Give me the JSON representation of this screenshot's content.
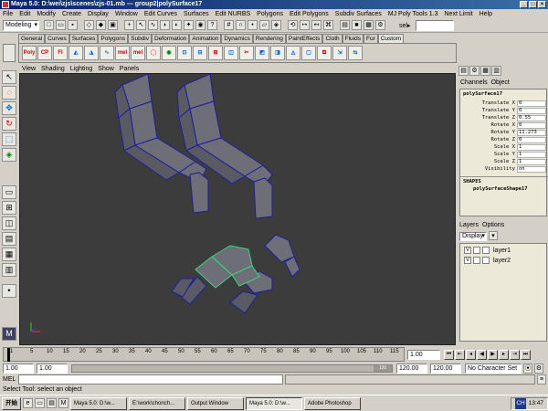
{
  "window": {
    "title": "Maya 5.0: D:\\wei\\zjs\\scenes\\zjs-01.mb  ---  group2|polySurface17"
  },
  "menubar": [
    "File",
    "Edit",
    "Modify",
    "Create",
    "Display",
    "Window",
    "Edit Curves",
    "Surfaces",
    "Edit NURBS",
    "Polygons",
    "Edit Polygons",
    "Subdiv Surfaces",
    "MJ Poly Tools 1.3",
    "Next Limit",
    "Help"
  ],
  "toolbar": {
    "mode": "Modeling",
    "sel_label": "sel▸"
  },
  "shelf": {
    "tabs": [
      "General",
      "Curves",
      "Surfaces",
      "Polygons",
      "Subdiv",
      "Deformation",
      "Animation",
      "Dynamics",
      "Rendering",
      "PaintEffects",
      "Cloth",
      "Fluids",
      "Fur",
      "Custom"
    ],
    "active_tab": "Custom",
    "icons": [
      "Poly",
      "CP",
      "FI",
      "",
      "",
      "mel",
      "mel",
      "",
      "",
      "",
      "",
      "",
      "",
      "",
      "",
      "",
      "",
      "",
      "",
      "",
      ""
    ]
  },
  "viewport": {
    "menu": [
      "View",
      "Shading",
      "Lighting",
      "Show",
      "Panels"
    ]
  },
  "channel_box": {
    "tabs": [
      "Channels",
      "Object"
    ],
    "object_name": "polySurface17",
    "channels": [
      {
        "name": "Translate X",
        "value": "0"
      },
      {
        "name": "Translate Y",
        "value": "0"
      },
      {
        "name": "Translate Z",
        "value": "0.55"
      },
      {
        "name": "Rotate X",
        "value": "0"
      },
      {
        "name": "Rotate Y",
        "value": "11.273"
      },
      {
        "name": "Rotate Z",
        "value": "0"
      },
      {
        "name": "Scale X",
        "value": "1"
      },
      {
        "name": "Scale Y",
        "value": "1"
      },
      {
        "name": "Scale Z",
        "value": "1"
      },
      {
        "name": "Visibility",
        "value": "on"
      }
    ],
    "shapes_header": "SHAPES",
    "shape_name": "polySurfaceShape17"
  },
  "layers": {
    "tabs": [
      "Layers",
      "Options"
    ],
    "display": "Display",
    "items": [
      {
        "v": "V",
        "name": "layer1"
      },
      {
        "v": "V",
        "name": "layer2"
      }
    ]
  },
  "timeline": {
    "ticks": [
      "1",
      "5",
      "10",
      "15",
      "20",
      "25",
      "30",
      "35",
      "40",
      "45",
      "50",
      "55",
      "60",
      "65",
      "70",
      "75",
      "80",
      "85",
      "90",
      "95",
      "100",
      "105",
      "110",
      "115"
    ],
    "current": "1.00"
  },
  "range": {
    "start": "1.00",
    "start2": "1.00",
    "end_inner": "120.00",
    "end": "120.00",
    "char_set": "No Character Set",
    "slider_value": "120"
  },
  "cmd": {
    "label": "MEL"
  },
  "help": {
    "text": "Select Tool: select an object"
  },
  "taskbar": {
    "start": "开始",
    "tasks": [
      {
        "label": "Maya 5.0: D:\\w...",
        "active": false
      },
      {
        "label": "E:\\work\\chonch...",
        "active": false
      },
      {
        "label": "Output Window",
        "active": false
      },
      {
        "label": "Maya 5.0: D:\\w...",
        "active": true
      },
      {
        "label": "Adobe Photoshop",
        "active": false
      }
    ],
    "tray": [
      "CH",
      "13:47"
    ]
  }
}
